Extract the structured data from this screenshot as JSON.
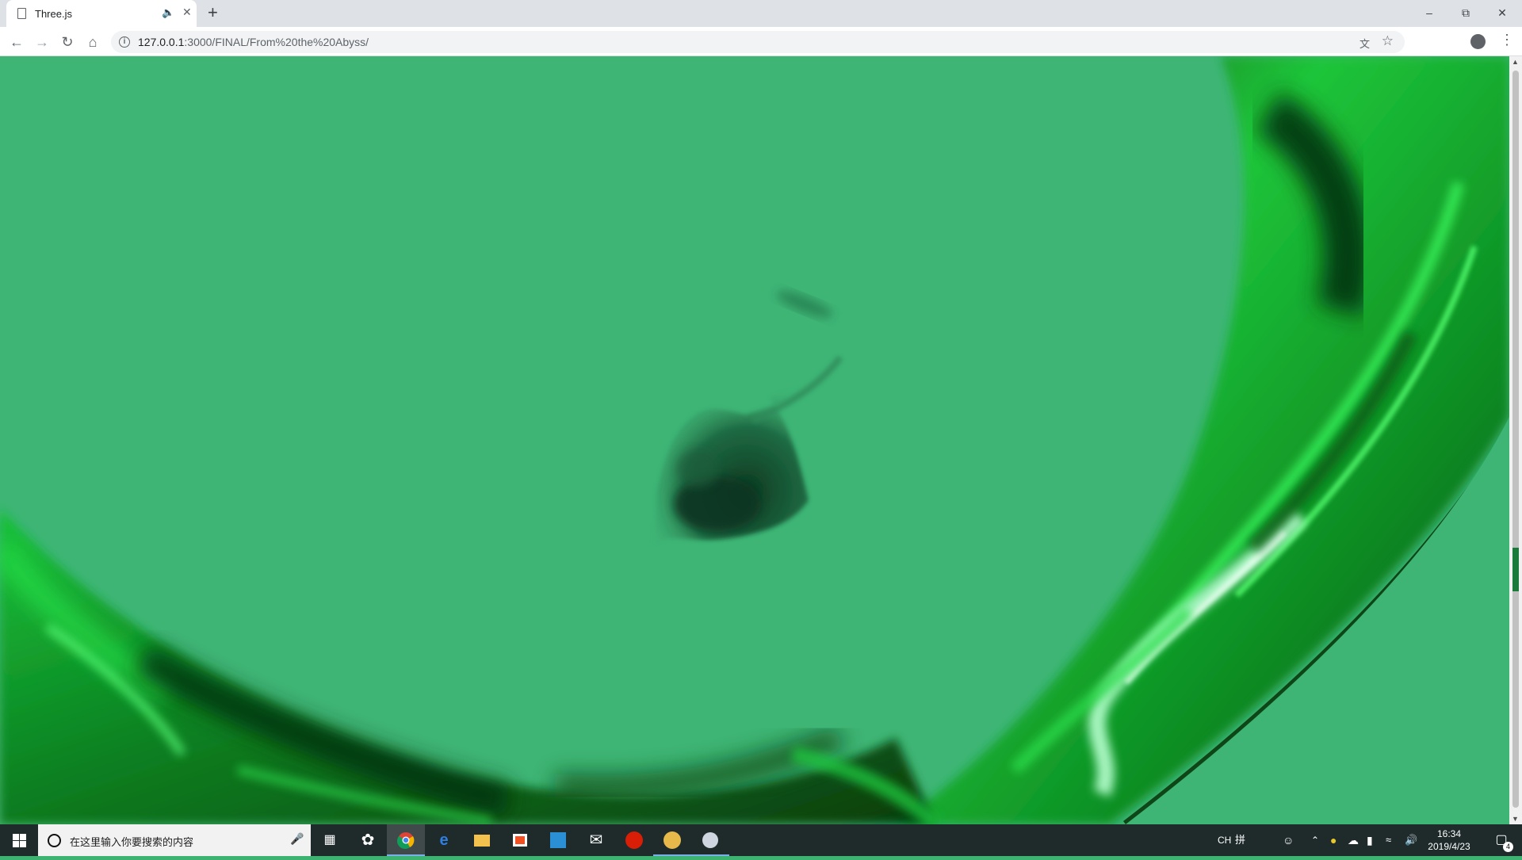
{
  "browser": {
    "tab_title": "Three.js",
    "url_host": "127.0.0.1",
    "url_path": ":3000/FINAL/From%20the%20Abyss/"
  },
  "scene": {
    "background_color": "#3eb575",
    "description_icon": "webgl-canvas"
  },
  "taskbar": {
    "search_placeholder": "在这里输入你要搜索的内容",
    "ime_label": "CH",
    "ime_mode": "拼",
    "time": "16:34",
    "date": "2019/4/23",
    "notification_count": "4",
    "apps": [
      {
        "icon": "task-view-icon"
      },
      {
        "icon": "pinwheel-app-icon"
      },
      {
        "icon": "chrome-icon"
      },
      {
        "icon": "edge-icon"
      },
      {
        "icon": "file-explorer-icon"
      },
      {
        "icon": "store-icon"
      },
      {
        "icon": "vscode-icon"
      },
      {
        "icon": "mail-icon"
      },
      {
        "icon": "netease-music-icon"
      },
      {
        "icon": "orange-app-icon"
      },
      {
        "icon": "paint-app-icon"
      }
    ]
  }
}
